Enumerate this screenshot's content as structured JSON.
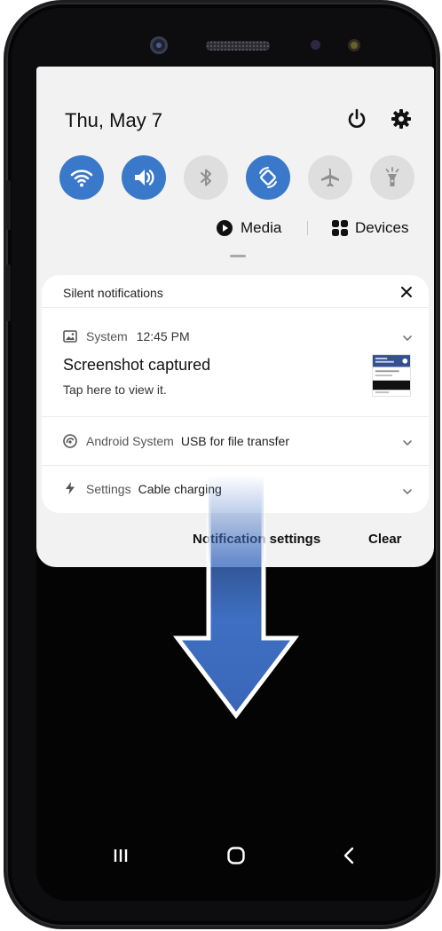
{
  "status": {
    "date": "Thu, May 7"
  },
  "quick_settings": [
    {
      "name": "wifi-icon",
      "active": true
    },
    {
      "name": "sound-icon",
      "active": true
    },
    {
      "name": "bluetooth-icon",
      "active": false
    },
    {
      "name": "auto-rotate-icon",
      "active": true
    },
    {
      "name": "airplane-icon",
      "active": false
    },
    {
      "name": "flashlight-icon",
      "active": false
    }
  ],
  "media_row": {
    "media_label": "Media",
    "devices_label": "Devices"
  },
  "notifications": {
    "header": "Silent notifications",
    "items": [
      {
        "app": "System",
        "time": "12:45 PM",
        "title": "Screenshot captured",
        "text": "Tap here to view it."
      },
      {
        "app": "Android System",
        "detail": "USB for file transfer"
      },
      {
        "app": "Settings",
        "detail": "Cable charging"
      }
    ]
  },
  "footer": {
    "settings_label": "Notification settings",
    "clear_label": "Clear"
  },
  "colors": {
    "toggle_on": "#3a79c9",
    "toggle_off": "#dedede",
    "panel_bg": "#f2f2f2",
    "arrow": "#3f6fc2"
  }
}
